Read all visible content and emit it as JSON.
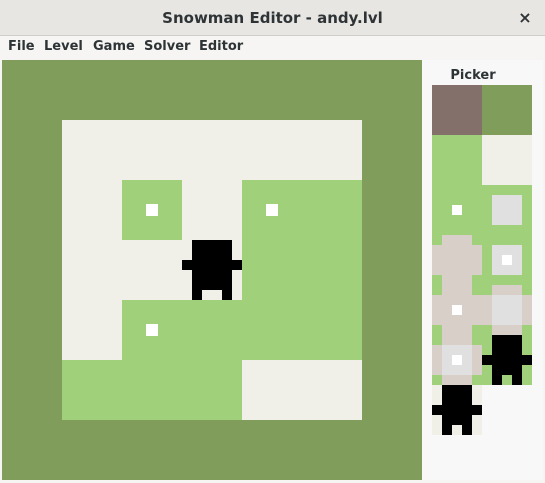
{
  "window": {
    "title": "Snowman Editor - andy.lvl",
    "close_symbol": "×"
  },
  "menu": {
    "items": [
      "File",
      "Level",
      "Game",
      "Solver",
      "Editor"
    ]
  },
  "picker": {
    "title": "Picker"
  },
  "colors": {
    "wall": "#809d5c",
    "snow": "#f0f0e8",
    "grass": "#a0d07a",
    "snowball": "#ffffff",
    "player": "#000000",
    "erase": "#84706a"
  }
}
